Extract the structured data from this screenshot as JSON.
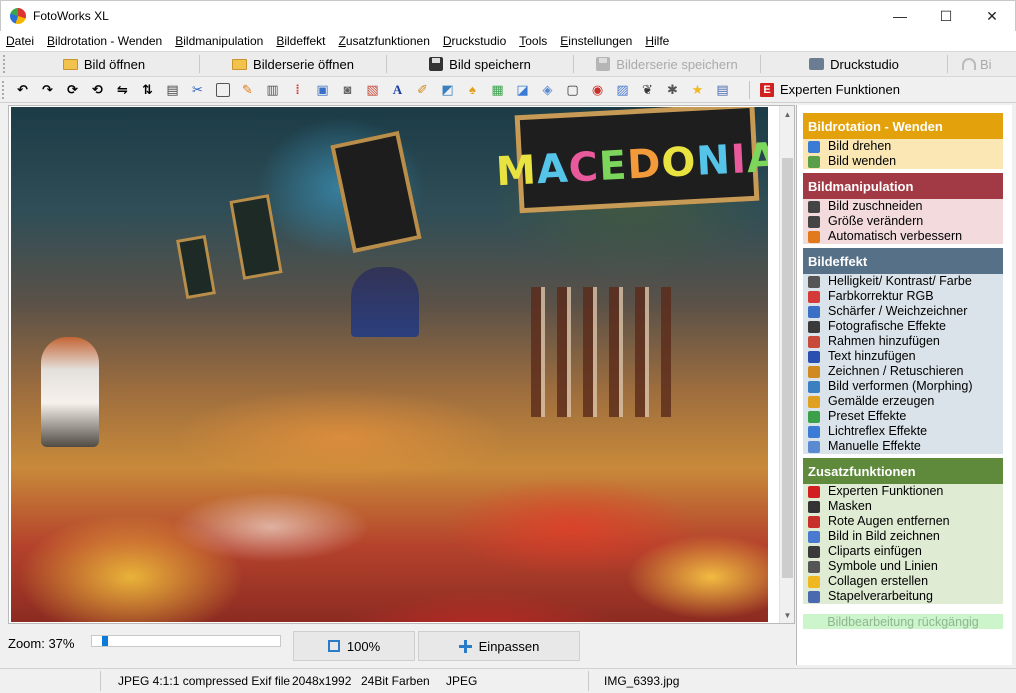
{
  "window": {
    "title": "FotoWorks XL",
    "minimize": "—",
    "maximize": "☐",
    "close": "✕"
  },
  "menu": [
    "Datei",
    "Bildrotation - Wenden",
    "Bildmanipulation",
    "Bildeffekt",
    "Zusatzfunktionen",
    "Druckstudio",
    "Tools",
    "Einstellungen",
    "Hilfe"
  ],
  "toolbar1": {
    "open_image": "Bild öffnen",
    "open_series": "Bilderserie öffnen",
    "save_image": "Bild speichern",
    "save_series": "Bilderserie speichern",
    "print_studio": "Druckstudio",
    "undo_truncated": "Bi"
  },
  "toolbar2": {
    "expert_badge": "E",
    "expert_label": "Experten Funktionen"
  },
  "photo": {
    "sign_text": "MACEDONIA",
    "sign_colors": [
      "#e9e341",
      "#55c4e8",
      "#e85a9b",
      "#7cd65b",
      "#f39a3a",
      "#e9e341",
      "#55c4e8",
      "#e85a9b",
      "#7cd65b"
    ]
  },
  "zoom": {
    "label": "Zoom: 37%",
    "value": 37,
    "btn_100": "100%",
    "btn_fit": "Einpassen"
  },
  "panel": {
    "groups": [
      {
        "title": "Bildrotation - Wenden",
        "color": "#e3a20b",
        "item_bg": "#fbe7b4",
        "items": [
          "Bild drehen",
          "Bild wenden"
        ],
        "icon_colors": [
          "#3a7bd5",
          "#5aa04a"
        ]
      },
      {
        "title": "Bildmanipulation",
        "color": "#a23a45",
        "item_bg": "#f2dadd",
        "items": [
          "Bild zuschneiden",
          "Größe verändern",
          "Automatisch verbessern"
        ],
        "icon_colors": [
          "#444444",
          "#444444",
          "#e07a1a"
        ]
      },
      {
        "title": "Bildeffekt",
        "color": "#567087",
        "item_bg": "#dbe3ea",
        "items": [
          "Helligkeit/ Kontrast/ Farbe",
          "Farbkorrektur RGB",
          "Schärfer / Weichzeichner",
          "Fotografische Effekte",
          "Rahmen hinzufügen",
          "Text hinzufügen",
          "Zeichnen / Retuschieren",
          "Bild verformen (Morphing)",
          "Gemälde erzeugen",
          "Preset Effekte",
          "Lichtreflex Effekte",
          "Manuelle Effekte"
        ],
        "icon_colors": [
          "#555555",
          "#d43a3a",
          "#3a6fc8",
          "#3a3a3a",
          "#c84a3a",
          "#2a4fb0",
          "#d08a20",
          "#3a80c0",
          "#e0a020",
          "#3aa04a",
          "#3a7bd5",
          "#5a8ad0"
        ]
      },
      {
        "title": "Zusatzfunktionen",
        "color": "#5f8a3c",
        "item_bg": "#dfebd3",
        "items": [
          "Experten Funktionen",
          "Masken",
          "Rote Augen entfernen",
          "Bild in Bild zeichnen",
          "Cliparts einfügen",
          "Symbole und Linien",
          "Collagen erstellen",
          "Stapelverarbeitung"
        ],
        "icon_colors": [
          "#d21f1f",
          "#333333",
          "#c8302a",
          "#4a7ad0",
          "#3a3a3a",
          "#555555",
          "#f0b820",
          "#4a6ab0"
        ]
      }
    ],
    "undo": "Bildbearbeitung rückgängig"
  },
  "status": {
    "format": "JPEG 4:1:1 compressed Exif file",
    "dimensions": "2048x1992",
    "colors": "24Bit Farben",
    "type": "JPEG",
    "filename": "IMG_6393.jpg"
  }
}
